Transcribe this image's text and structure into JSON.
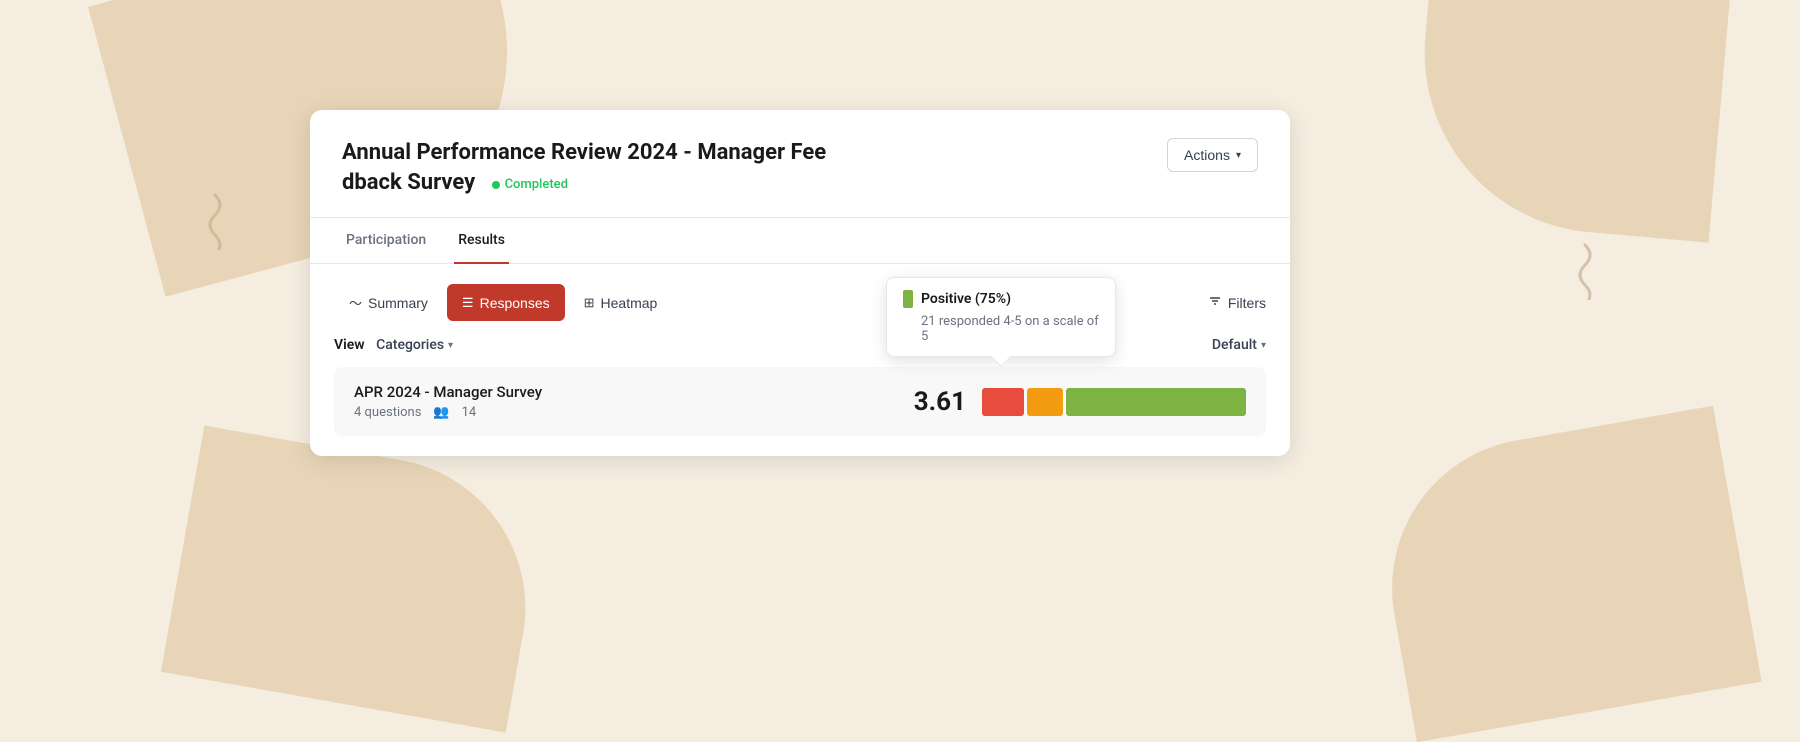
{
  "background": {
    "color": "#f5ede0",
    "shape_color": "#e8d5b7"
  },
  "header": {
    "title_line1": "Annual Performance Review 2024 - Manager Fee",
    "title_line2": "dback Survey",
    "status": "Completed",
    "actions_label": "Actions"
  },
  "tabs": {
    "participation": "Participation",
    "results": "Results",
    "active": "Results"
  },
  "sub_tabs": {
    "summary": "Summary",
    "responses": "Responses",
    "heatmap": "Heatmap",
    "active": "Responses"
  },
  "filters": {
    "label": "Filters"
  },
  "view": {
    "label": "View",
    "dropdown_label": "Categories",
    "default_label": "Default"
  },
  "survey_row": {
    "name": "APR 2024 - Manager Survey",
    "questions_count": "4 questions",
    "people_count": "14",
    "score": "3.61"
  },
  "tooltip": {
    "title": "Positive (75%)",
    "description": "21 responded 4-5 on a scale of 5"
  },
  "rating_bar": {
    "red_width": 42,
    "orange_width": 36,
    "green_width": 180
  }
}
